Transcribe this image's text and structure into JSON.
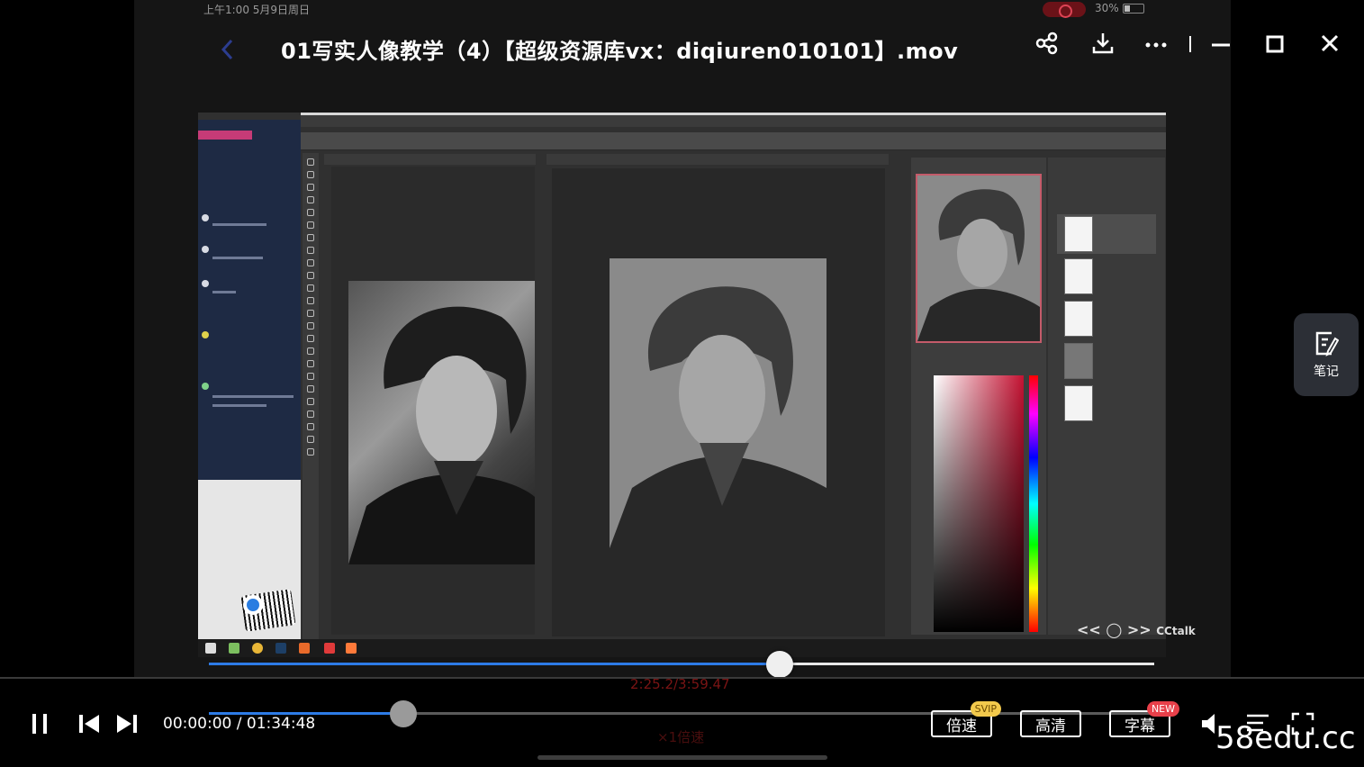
{
  "status_bar": {
    "time": "上午1:00",
    "date": "5月9日周日",
    "battery": "30%"
  },
  "header": {
    "title": "01写实人像教学（4）【超级资源库vx：diqiuren010101】.mov",
    "icons": [
      "back-icon",
      "share-icon",
      "download-icon",
      "more-icon",
      "minimize-icon",
      "maximize-icon",
      "close-icon"
    ]
  },
  "video_frame": {
    "embedded_time": "2:25.2/3:59.47",
    "embedded_speed": "×1倍速",
    "watermark": "CCtalk"
  },
  "side_panel": {
    "notes_label": "笔记"
  },
  "player": {
    "time": "00:00:00 / 01:34:48",
    "progress": 0.2,
    "inner_progress": 0.6,
    "speed_label": "倍速",
    "speed_badge": "SVIP",
    "quality_label": "高清",
    "subtitle_label": "字幕",
    "subtitle_badge": "NEW"
  },
  "site_watermark": "58edu.cc",
  "colors": {
    "accent": "#2d7be6",
    "svip": "#f2c94c",
    "new_badge": "#e8404a"
  }
}
